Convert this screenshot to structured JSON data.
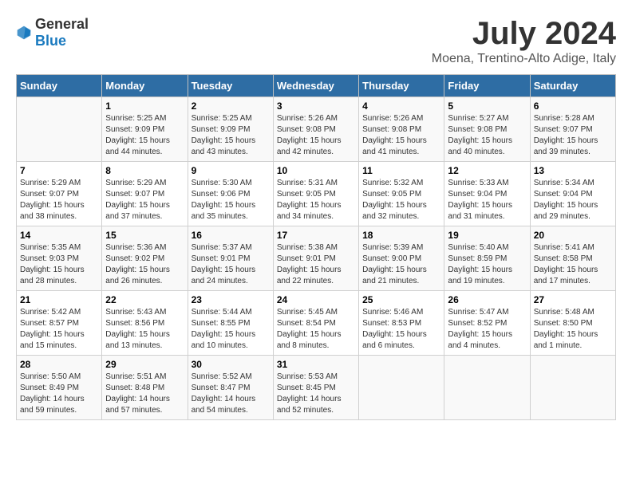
{
  "logo": {
    "general": "General",
    "blue": "Blue"
  },
  "title": "July 2024",
  "location": "Moena, Trentino-Alto Adige, Italy",
  "days_header": [
    "Sunday",
    "Monday",
    "Tuesday",
    "Wednesday",
    "Thursday",
    "Friday",
    "Saturday"
  ],
  "weeks": [
    [
      {
        "day": "",
        "info": ""
      },
      {
        "day": "1",
        "info": "Sunrise: 5:25 AM\nSunset: 9:09 PM\nDaylight: 15 hours\nand 44 minutes."
      },
      {
        "day": "2",
        "info": "Sunrise: 5:25 AM\nSunset: 9:09 PM\nDaylight: 15 hours\nand 43 minutes."
      },
      {
        "day": "3",
        "info": "Sunrise: 5:26 AM\nSunset: 9:08 PM\nDaylight: 15 hours\nand 42 minutes."
      },
      {
        "day": "4",
        "info": "Sunrise: 5:26 AM\nSunset: 9:08 PM\nDaylight: 15 hours\nand 41 minutes."
      },
      {
        "day": "5",
        "info": "Sunrise: 5:27 AM\nSunset: 9:08 PM\nDaylight: 15 hours\nand 40 minutes."
      },
      {
        "day": "6",
        "info": "Sunrise: 5:28 AM\nSunset: 9:07 PM\nDaylight: 15 hours\nand 39 minutes."
      }
    ],
    [
      {
        "day": "7",
        "info": "Sunrise: 5:29 AM\nSunset: 9:07 PM\nDaylight: 15 hours\nand 38 minutes."
      },
      {
        "day": "8",
        "info": "Sunrise: 5:29 AM\nSunset: 9:07 PM\nDaylight: 15 hours\nand 37 minutes."
      },
      {
        "day": "9",
        "info": "Sunrise: 5:30 AM\nSunset: 9:06 PM\nDaylight: 15 hours\nand 35 minutes."
      },
      {
        "day": "10",
        "info": "Sunrise: 5:31 AM\nSunset: 9:05 PM\nDaylight: 15 hours\nand 34 minutes."
      },
      {
        "day": "11",
        "info": "Sunrise: 5:32 AM\nSunset: 9:05 PM\nDaylight: 15 hours\nand 32 minutes."
      },
      {
        "day": "12",
        "info": "Sunrise: 5:33 AM\nSunset: 9:04 PM\nDaylight: 15 hours\nand 31 minutes."
      },
      {
        "day": "13",
        "info": "Sunrise: 5:34 AM\nSunset: 9:04 PM\nDaylight: 15 hours\nand 29 minutes."
      }
    ],
    [
      {
        "day": "14",
        "info": "Sunrise: 5:35 AM\nSunset: 9:03 PM\nDaylight: 15 hours\nand 28 minutes."
      },
      {
        "day": "15",
        "info": "Sunrise: 5:36 AM\nSunset: 9:02 PM\nDaylight: 15 hours\nand 26 minutes."
      },
      {
        "day": "16",
        "info": "Sunrise: 5:37 AM\nSunset: 9:01 PM\nDaylight: 15 hours\nand 24 minutes."
      },
      {
        "day": "17",
        "info": "Sunrise: 5:38 AM\nSunset: 9:01 PM\nDaylight: 15 hours\nand 22 minutes."
      },
      {
        "day": "18",
        "info": "Sunrise: 5:39 AM\nSunset: 9:00 PM\nDaylight: 15 hours\nand 21 minutes."
      },
      {
        "day": "19",
        "info": "Sunrise: 5:40 AM\nSunset: 8:59 PM\nDaylight: 15 hours\nand 19 minutes."
      },
      {
        "day": "20",
        "info": "Sunrise: 5:41 AM\nSunset: 8:58 PM\nDaylight: 15 hours\nand 17 minutes."
      }
    ],
    [
      {
        "day": "21",
        "info": "Sunrise: 5:42 AM\nSunset: 8:57 PM\nDaylight: 15 hours\nand 15 minutes."
      },
      {
        "day": "22",
        "info": "Sunrise: 5:43 AM\nSunset: 8:56 PM\nDaylight: 15 hours\nand 13 minutes."
      },
      {
        "day": "23",
        "info": "Sunrise: 5:44 AM\nSunset: 8:55 PM\nDaylight: 15 hours\nand 10 minutes."
      },
      {
        "day": "24",
        "info": "Sunrise: 5:45 AM\nSunset: 8:54 PM\nDaylight: 15 hours\nand 8 minutes."
      },
      {
        "day": "25",
        "info": "Sunrise: 5:46 AM\nSunset: 8:53 PM\nDaylight: 15 hours\nand 6 minutes."
      },
      {
        "day": "26",
        "info": "Sunrise: 5:47 AM\nSunset: 8:52 PM\nDaylight: 15 hours\nand 4 minutes."
      },
      {
        "day": "27",
        "info": "Sunrise: 5:48 AM\nSunset: 8:50 PM\nDaylight: 15 hours\nand 1 minute."
      }
    ],
    [
      {
        "day": "28",
        "info": "Sunrise: 5:50 AM\nSunset: 8:49 PM\nDaylight: 14 hours\nand 59 minutes."
      },
      {
        "day": "29",
        "info": "Sunrise: 5:51 AM\nSunset: 8:48 PM\nDaylight: 14 hours\nand 57 minutes."
      },
      {
        "day": "30",
        "info": "Sunrise: 5:52 AM\nSunset: 8:47 PM\nDaylight: 14 hours\nand 54 minutes."
      },
      {
        "day": "31",
        "info": "Sunrise: 5:53 AM\nSunset: 8:45 PM\nDaylight: 14 hours\nand 52 minutes."
      },
      {
        "day": "",
        "info": ""
      },
      {
        "day": "",
        "info": ""
      },
      {
        "day": "",
        "info": ""
      }
    ]
  ]
}
